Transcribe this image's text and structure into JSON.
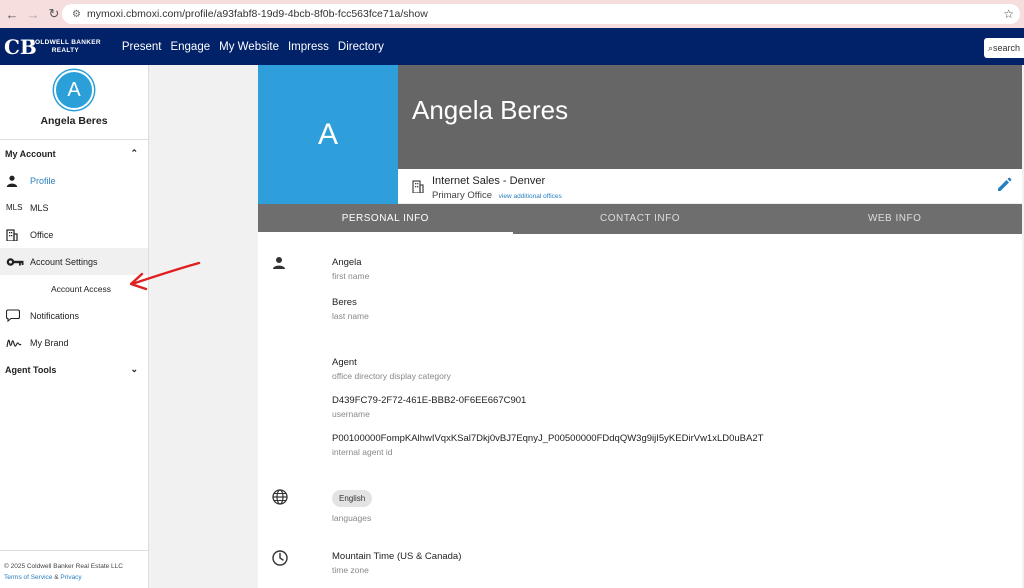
{
  "browser": {
    "url": "mymoxi.cbmoxi.com/profile/a93fabf8-19d9-4bcb-8f0b-fcc563fce71a/show"
  },
  "header": {
    "brand_line1": "COLDWELL BANKER",
    "brand_line2": "REALTY",
    "nav": [
      "Present",
      "Engage",
      "My Website",
      "Impress",
      "Directory"
    ],
    "search_label": "search",
    "bg_color": "#012169"
  },
  "sidebar": {
    "avatar_letter": "A",
    "user_name": "Angela Beres",
    "my_account_label": "My Account",
    "items": [
      {
        "label": "Profile",
        "icon": "person-icon"
      },
      {
        "label": "MLS",
        "icon_text": "MLS"
      },
      {
        "label": "Office",
        "icon": "building-icon"
      },
      {
        "label": "Account Settings",
        "icon": "key-icon"
      },
      {
        "label": "Notifications",
        "icon": "chat-bubble-icon"
      },
      {
        "label": "My Brand",
        "icon": "signature-icon"
      }
    ],
    "sub_item": "Account Access",
    "agent_tools_label": "Agent Tools",
    "footer_copyright": "© 2025 Coldwell Banker Real Estate LLC",
    "footer_terms": "Terms of Service",
    "footer_amp": "&",
    "footer_privacy": "Privacy"
  },
  "profile": {
    "avatar_letter": "A",
    "name": "Angela Beres",
    "office_name": "Internet Sales - Denver",
    "office_type": "Primary Office",
    "view_offices_link": "view additional offices",
    "accent_color": "#2f9fdb"
  },
  "tabs": [
    "PERSONAL INFO",
    "CONTACT INFO",
    "WEB INFO"
  ],
  "personal_info": {
    "first_name": {
      "value": "Angela",
      "label": "first name"
    },
    "last_name": {
      "value": "Beres",
      "label": "last name"
    },
    "display_category": {
      "value": "Agent",
      "label": "office directory display category"
    },
    "username": {
      "value": "D439FC79-2F72-461E-BBB2-0F6EE667C901",
      "label": "username"
    },
    "internal_id": {
      "value": "P00100000FompKAlhwIVqxKSal7Dkj0vBJ7EqnyJ_P00500000FDdqQW3g9ijI5yKEDirVw1xLD0uBA2T",
      "label": "internal agent id"
    },
    "language": {
      "value": "English",
      "label": "languages"
    },
    "time_zone": {
      "value": "Mountain Time (US & Canada)",
      "label": "time zone"
    }
  }
}
